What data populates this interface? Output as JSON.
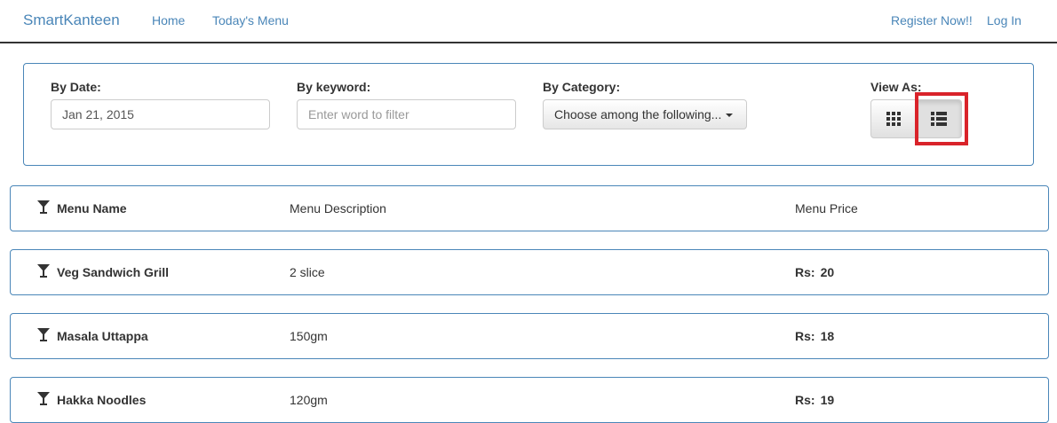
{
  "navbar": {
    "brand": "SmartKanteen",
    "links": [
      "Home",
      "Today's Menu"
    ],
    "right_links": [
      "Register Now!!",
      "Log In"
    ]
  },
  "filters": {
    "date_label": "By Date:",
    "date_value": "Jan 21, 2015",
    "keyword_label": "By keyword:",
    "keyword_placeholder": "Enter word to filter",
    "category_label": "By Category:",
    "category_value": "Choose among the following...",
    "view_label": "View As:",
    "view_options": [
      "grid-icon",
      "list-icon"
    ],
    "selected_view": "list"
  },
  "menu": {
    "header": {
      "name": "Menu Name",
      "description": "Menu Description",
      "price": "Menu Price"
    },
    "items": [
      {
        "name": "Veg Sandwich Grill",
        "description": "2 slice",
        "currency": "Rs:",
        "price": "20"
      },
      {
        "name": "Masala Uttappa",
        "description": "150gm",
        "currency": "Rs:",
        "price": "18"
      },
      {
        "name": "Hakka Noodles",
        "description": "120gm",
        "currency": "Rs:",
        "price": "19"
      }
    ]
  },
  "colors": {
    "link": "#4a86b8",
    "highlight": "#d9232a",
    "border": "#4a86b8"
  }
}
